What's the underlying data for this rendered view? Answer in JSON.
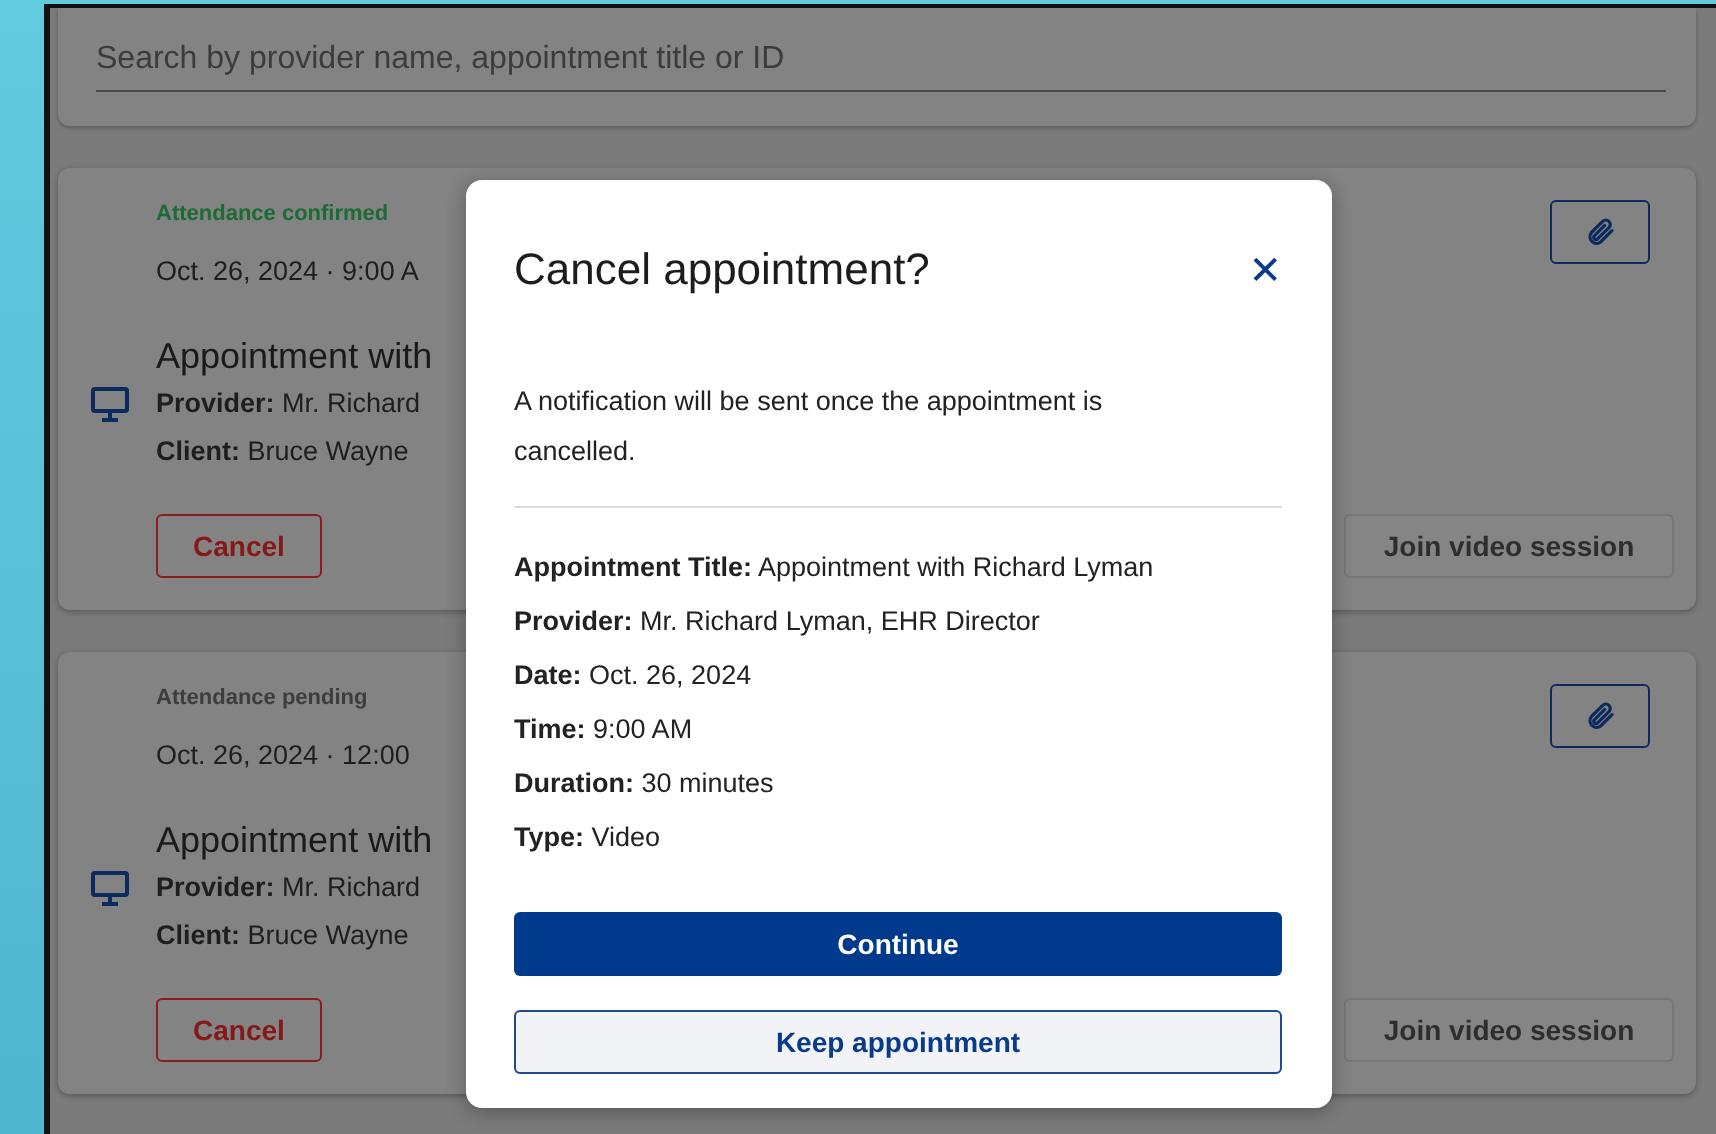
{
  "search": {
    "placeholder": "Search by provider name, appointment title or ID"
  },
  "appointments": [
    {
      "kind": "confirmed",
      "status": "Attendance confirmed",
      "datetime": "Oct. 26, 2024 · 9:00 A",
      "title": "Appointment with",
      "provider_label": "Provider:",
      "provider_value": "Mr. Richard",
      "client_label": "Client:",
      "client_value": "Bruce Wayne",
      "cancel": "Cancel",
      "join": "Join video session"
    },
    {
      "kind": "pending",
      "status": "Attendance pending",
      "datetime": "Oct. 26, 2024 · 12:00",
      "title": "Appointment with",
      "provider_label": "Provider:",
      "provider_value": "Mr. Richard",
      "client_label": "Client:",
      "client_value": "Bruce Wayne",
      "cancel": "Cancel",
      "join": "Join video session"
    }
  ],
  "modal": {
    "title": "Cancel appointment?",
    "close": "✕",
    "message": "A notification will be sent once the appointment is cancelled.",
    "details": [
      {
        "label": "Appointment Title:",
        "value": "Appointment with Richard Lyman"
      },
      {
        "label": "Provider:",
        "value": "Mr. Richard Lyman, EHR Director"
      },
      {
        "label": "Date:",
        "value": "Oct. 26, 2024"
      },
      {
        "label": "Time:",
        "value": "9:00 AM"
      },
      {
        "label": "Duration:",
        "value": "30 minutes"
      },
      {
        "label": "Type:",
        "value": "Video"
      }
    ],
    "continue": "Continue",
    "keep": "Keep appointment"
  }
}
